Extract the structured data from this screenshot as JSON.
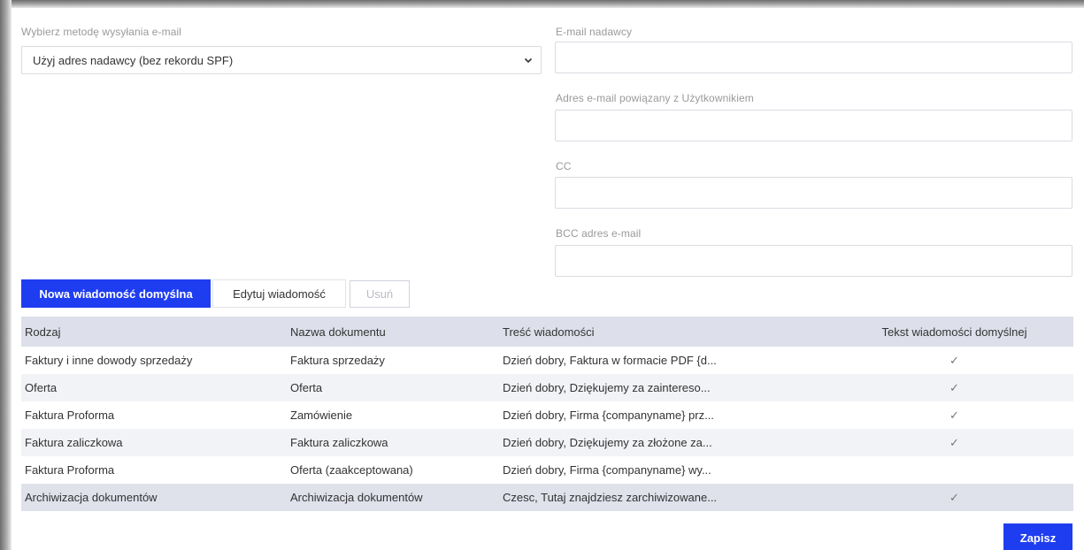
{
  "method": {
    "label": "Wybierz metodę wysyłania e-mail",
    "selected": "Użyj adres nadawcy (bez rekordu SPF)"
  },
  "fields": {
    "sender_label": "E-mail nadawcy",
    "sender_value": "",
    "user_email_label": "Adres e-mail powiązany z Użytkownikiem",
    "user_email_value": "",
    "cc_label": "CC",
    "cc_value": "",
    "bcc_label": "BCC adres e-mail",
    "bcc_value": ""
  },
  "toolbar": {
    "new_label": "Nowa wiadomość domyślna",
    "edit_label": "Edytuj wiadomość",
    "delete_label": "Usuń"
  },
  "table": {
    "headers": [
      "Rodzaj",
      "Nazwa dokumentu",
      "Treść wiadomości",
      "Tekst wiadomości domyślnej"
    ],
    "rows": [
      [
        "Faktury i inne dowody sprzedaży",
        "Faktura sprzedaży",
        "Dzień dobry, Faktura w formacie PDF {d...",
        "✓"
      ],
      [
        "Oferta",
        "Oferta",
        "Dzień dobry, Dziękujemy za zaintereso...",
        "✓"
      ],
      [
        "Faktura Proforma",
        "Zamówienie",
        "Dzień dobry, Firma {companyname} prz...",
        "✓"
      ],
      [
        "Faktura zaliczkowa",
        "Faktura zaliczkowa",
        "Dzień dobry, Dziękujemy za złożone za...",
        "✓"
      ],
      [
        "Faktura Proforma",
        "Oferta (zaakceptowana)",
        "Dzień dobry, Firma {companyname} wy...",
        ""
      ],
      [
        "Archiwizacja dokumentów",
        "Archiwizacja dokumentów",
        "Czesc, Tutaj znajdziesz zarchiwizowane...",
        "✓"
      ]
    ]
  },
  "save_label": "Zapisz",
  "icons": {
    "dropdown": "chevron-down-icon",
    "check": "check-icon"
  },
  "colors": {
    "primary": "#1f3df0",
    "header_bg": "#dde0ea"
  }
}
